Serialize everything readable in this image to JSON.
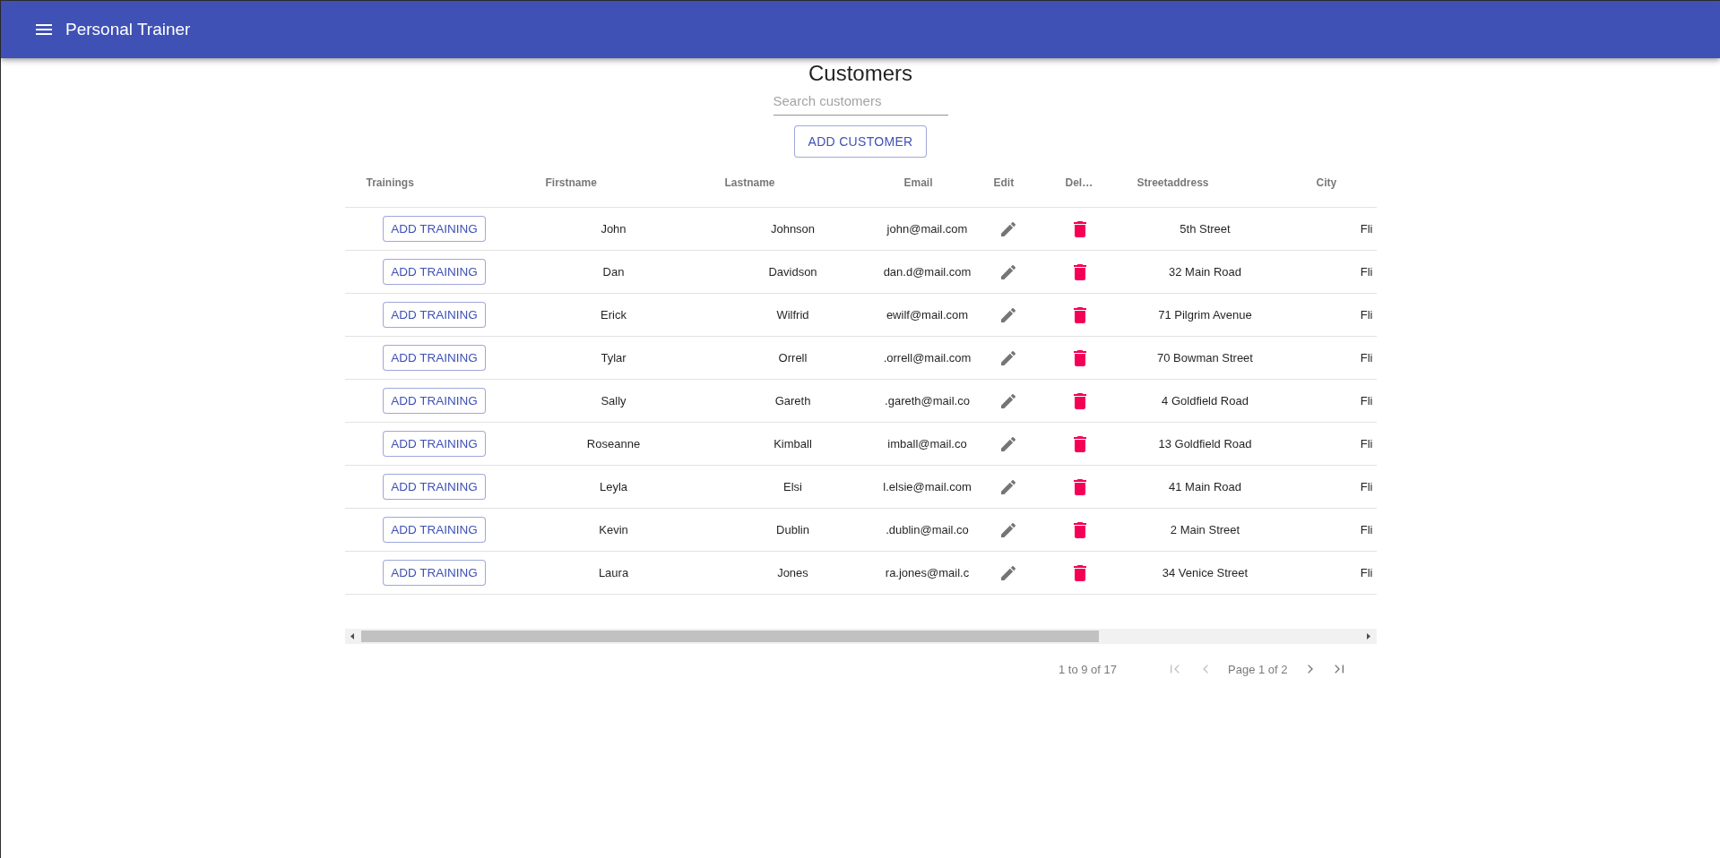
{
  "app_bar": {
    "title": "Personal Trainer"
  },
  "customers": {
    "title": "Customers",
    "search": {
      "placeholder": "Search customers"
    },
    "add_button": "ADD CUSTOMER"
  },
  "table": {
    "columns": [
      "Trainings",
      "Firstname",
      "Lastname",
      "Email",
      "Edit",
      "Del…",
      "Streetaddress",
      "City"
    ],
    "rows": [
      {
        "training_button": "ADD TRAINING",
        "firstname": "John",
        "lastname": "Johnson",
        "email": "john@mail.com",
        "streetaddress": "5th Street",
        "city": "Fli"
      },
      {
        "training_button": "ADD TRAINING",
        "firstname": "Dan",
        "lastname": "Davidson",
        "email": "dan.d@mail.com",
        "streetaddress": "32 Main Road",
        "city": "Fli"
      },
      {
        "training_button": "ADD TRAINING",
        "firstname": "Erick",
        "lastname": "Wilfrid",
        "email": "ewilf@mail.com",
        "streetaddress": "71 Pilgrim Avenue",
        "city": "Fli"
      },
      {
        "training_button": "ADD TRAINING",
        "firstname": "Tylar",
        "lastname": "Orrell",
        "email": ".orrell@mail.com",
        "streetaddress": "70 Bowman Street",
        "city": "Fli"
      },
      {
        "training_button": "ADD TRAINING",
        "firstname": "Sally",
        "lastname": "Gareth",
        "email": ".gareth@mail.co",
        "streetaddress": "4 Goldfield Road",
        "city": "Fli"
      },
      {
        "training_button": "ADD TRAINING",
        "firstname": "Roseanne",
        "lastname": "Kimball",
        "email": "imball@mail.co",
        "streetaddress": "13 Goldfield Road",
        "city": "Fli"
      },
      {
        "training_button": "ADD TRAINING",
        "firstname": "Leyla",
        "lastname": "Elsi",
        "email": "l.elsie@mail.com",
        "streetaddress": "41 Main Road",
        "city": "Fli"
      },
      {
        "training_button": "ADD TRAINING",
        "firstname": "Kevin",
        "lastname": "Dublin",
        "email": ".dublin@mail.co",
        "streetaddress": "2 Main Street",
        "city": "Fli"
      },
      {
        "training_button": "ADD TRAINING",
        "firstname": "Laura",
        "lastname": "Jones",
        "email": "ra.jones@mail.c",
        "streetaddress": "34 Venice Street",
        "city": "Fli"
      }
    ]
  },
  "pagination": {
    "summary": "1 to 9 of 17",
    "page_label": "Page 1 of 2",
    "buttons": [
      {
        "kind": "first",
        "disabled": true
      },
      {
        "kind": "previous",
        "disabled": true
      },
      {
        "kind": "next",
        "disabled": false
      },
      {
        "kind": "last",
        "disabled": false
      }
    ]
  }
}
